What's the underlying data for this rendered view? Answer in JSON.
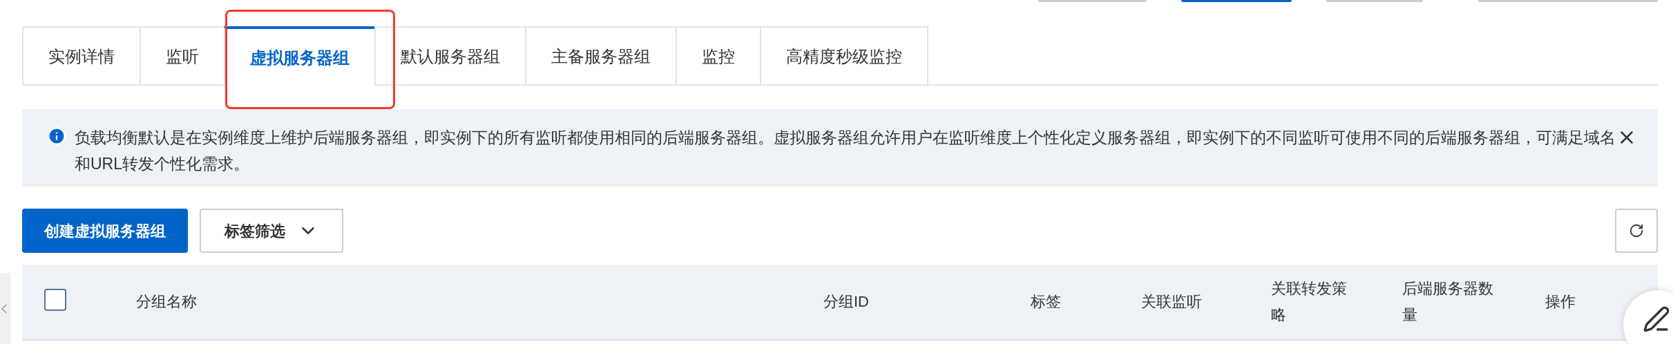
{
  "top_buttons": [
    {
      "selected": false
    },
    {
      "selected": true
    },
    {
      "selected": false
    },
    {
      "selected": false
    }
  ],
  "tabs": [
    {
      "label": "实例详情",
      "selected": false
    },
    {
      "label": "监听",
      "selected": false
    },
    {
      "label": "虚拟服务器组",
      "selected": true
    },
    {
      "label": "默认服务器组",
      "selected": false
    },
    {
      "label": "主备服务器组",
      "selected": false
    },
    {
      "label": "监控",
      "selected": false
    },
    {
      "label": "高精度秒级监控",
      "selected": false
    }
  ],
  "notice": {
    "text": "负载均衡默认是在实例维度上维护后端服务器组，即实例下的所有监听都使用相同的后端服务器组。虚拟服务器组允许用户在监听维度上个性化定义服务器组，即实例下的不同监听可使用不同的后端服务器组，可满足域名和URL转发个性化需求。"
  },
  "toolbar": {
    "create_button": "创建虚拟服务器组",
    "filter_button": "标签筛选"
  },
  "table": {
    "select_all_checked": false,
    "columns": [
      "分组名称",
      "分组ID",
      "标签",
      "关联监听",
      "关联转发策略",
      "后端服务器数量",
      "操作"
    ]
  }
}
